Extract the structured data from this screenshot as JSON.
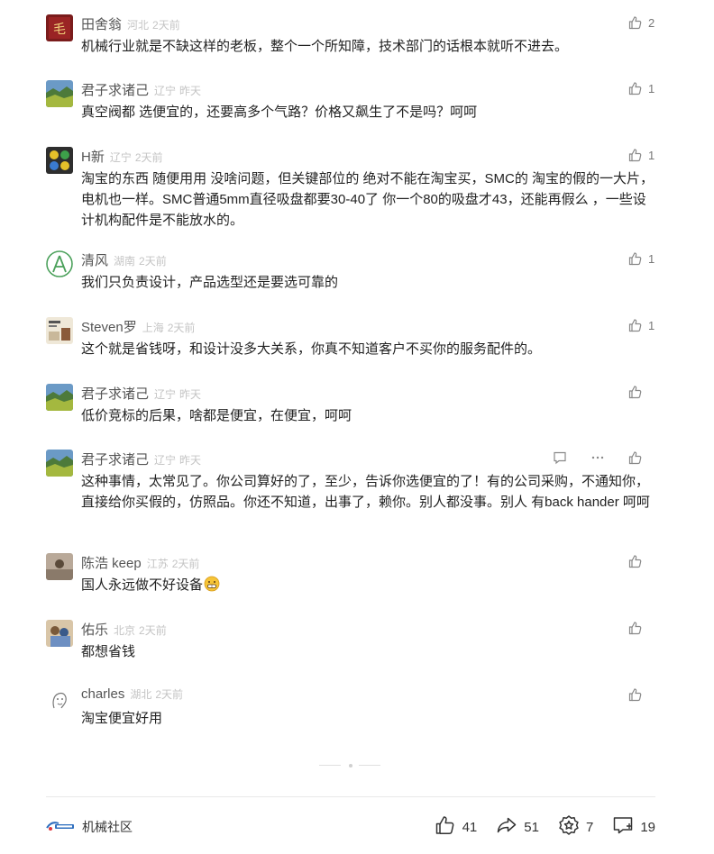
{
  "comments": [
    {
      "name": "田舍翁",
      "location": "河北",
      "time": "2天前",
      "likes": "2",
      "text": "机械行业就是不缺这样的老板，整个一个所知障，技术部门的话根本就听不进去。"
    },
    {
      "name": "君子求诸己",
      "location": "辽宁",
      "time": "昨天",
      "likes": "1",
      "text": "真空阀都 选便宜的，还要高多个气路？价格又飙生了不是吗？呵呵"
    },
    {
      "name": "H新",
      "location": "辽宁",
      "time": "2天前",
      "likes": "1",
      "text": "淘宝的东西 随便用用 没啥问题，但关键部位的 绝对不能在淘宝买，SMC的 淘宝的假的一大片，电机也一样。SMC普通5mm直径吸盘都要30-40了 你一个80的吸盘才43，还能再假么 ，一些设计机构配件是不能放水的。"
    },
    {
      "name": "清风",
      "location": "湖南",
      "time": "2天前",
      "likes": "1",
      "text": "我们只负责设计，产品选型还是要选可靠的"
    },
    {
      "name": "Steven罗",
      "location": "上海",
      "time": "2天前",
      "likes": "1",
      "text": "这个就是省钱呀，和设计没多大关系，你真不知道客户不买你的服务配件的。"
    },
    {
      "name": "君子求诸己",
      "location": "辽宁",
      "time": "昨天",
      "likes": "",
      "text": "低价竞标的后果，啥都是便宜，在便宜，呵呵"
    },
    {
      "name": "君子求诸己",
      "location": "辽宁",
      "time": "昨天",
      "likes": "",
      "text": "这种事情，太常见了。你公司算好的了，至少，告诉你选便宜的了！有的公司采购，不通知你，直接给你买假的，仿照品。你还不知道，出事了，赖你。别人都没事。别人 有back hander 呵呵"
    },
    {
      "name": "陈浩 keep",
      "location": "江苏",
      "time": "2天前",
      "likes": "",
      "text": "国人永远做不好设备"
    },
    {
      "name": "佑乐",
      "location": "北京",
      "time": "2天前",
      "likes": "",
      "text": "都想省钱"
    },
    {
      "name": "charles",
      "location": "湖北",
      "time": "2天前",
      "likes": "",
      "text": "淘宝便宜好用"
    }
  ],
  "footer": {
    "brand": "机械社区",
    "likes": "41",
    "shares": "51",
    "favorites": "7",
    "comments": "19"
  },
  "colors": {
    "accent": "#e0393e",
    "text": "#222222",
    "muted": "#c4c4c4"
  }
}
